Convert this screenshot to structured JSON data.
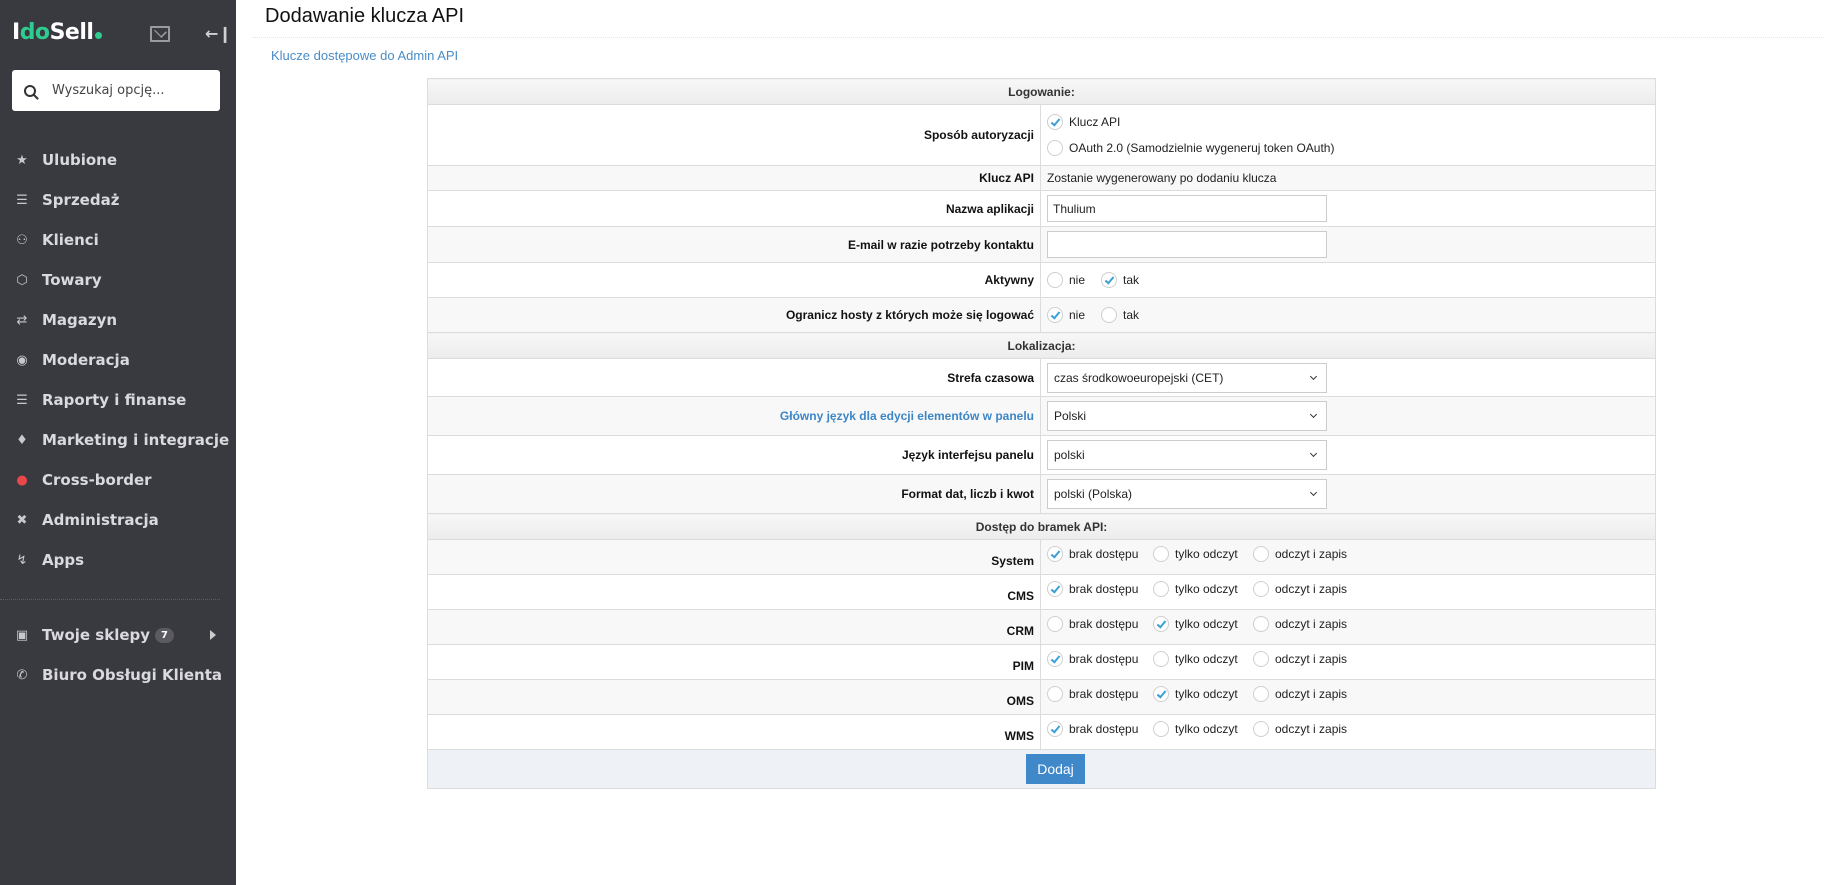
{
  "sidebar": {
    "logo": {
      "part1": "I",
      "part2": "do",
      "part3": "Sell"
    },
    "search_placeholder": "Wyszukaj opcję...",
    "items": [
      {
        "label": "Ulubione",
        "icon": "star-icon"
      },
      {
        "label": "Sprzedaż",
        "icon": "coins-icon"
      },
      {
        "label": "Klienci",
        "icon": "users-icon"
      },
      {
        "label": "Towary",
        "icon": "box-icon"
      },
      {
        "label": "Magazyn",
        "icon": "warehouse-icon"
      },
      {
        "label": "Moderacja",
        "icon": "camera-icon"
      },
      {
        "label": "Raporty i finanse",
        "icon": "layers-icon"
      },
      {
        "label": "Marketing i integracje",
        "icon": "tag-icon"
      },
      {
        "label": "Cross-border",
        "icon": "globe-icon"
      },
      {
        "label": "Administracja",
        "icon": "expand-icon"
      },
      {
        "label": "Apps",
        "icon": "bolt-icon"
      }
    ],
    "shops": {
      "label": "Twoje sklepy",
      "count": "7"
    },
    "support": {
      "label": "Biuro Obsługi Klienta"
    }
  },
  "page": {
    "title": "Dodawanie klucza API",
    "breadcrumb_link": "Klucze dostępowe do Admin API"
  },
  "form": {
    "section_login": "Logowanie:",
    "auth_label": "Sposób autoryzacji",
    "auth_options": [
      "Klucz API",
      "OAuth 2.0 (Samodzielnie wygeneruj token OAuth)"
    ],
    "auth_selected": 0,
    "api_key_label": "Klucz API",
    "api_key_value": "Zostanie wygenerowany po dodaniu klucza",
    "app_name_label": "Nazwa aplikacji",
    "app_name_value": "Thulium",
    "email_label": "E-mail w razie potrzeby kontaktu",
    "email_value": "",
    "active_label": "Aktywny",
    "active_options": [
      "nie",
      "tak"
    ],
    "active_selected": 1,
    "restrict_label": "Ogranicz hosty z których może się logować",
    "restrict_options": [
      "nie",
      "tak"
    ],
    "restrict_selected": 0,
    "section_locale": "Lokalizacja:",
    "timezone_label": "Strefa czasowa",
    "timezone_value": "czas środkowoeuropejski (CET)",
    "main_lang_label": "Główny język dla edycji elementów w panelu",
    "main_lang_value": "Polski",
    "ui_lang_label": "Język interfejsu panelu",
    "ui_lang_value": "polski",
    "format_label": "Format dat, liczb i kwot",
    "format_value": "polski (Polska)",
    "section_gates": "Dostęp do bramek API:",
    "gate_options": [
      "brak dostępu",
      "tylko odczyt",
      "odczyt i zapis"
    ],
    "gates": [
      {
        "name": "System",
        "selected": 0
      },
      {
        "name": "CMS",
        "selected": 0
      },
      {
        "name": "CRM",
        "selected": 1
      },
      {
        "name": "PIM",
        "selected": 0
      },
      {
        "name": "OMS",
        "selected": 1
      },
      {
        "name": "WMS",
        "selected": 0
      }
    ],
    "submit_label": "Dodaj"
  },
  "colors": {
    "accent": "#3f88c9",
    "sidebar_bg": "#393940",
    "brand_green": "#2ecc8f",
    "check": "#3aa0d6"
  }
}
